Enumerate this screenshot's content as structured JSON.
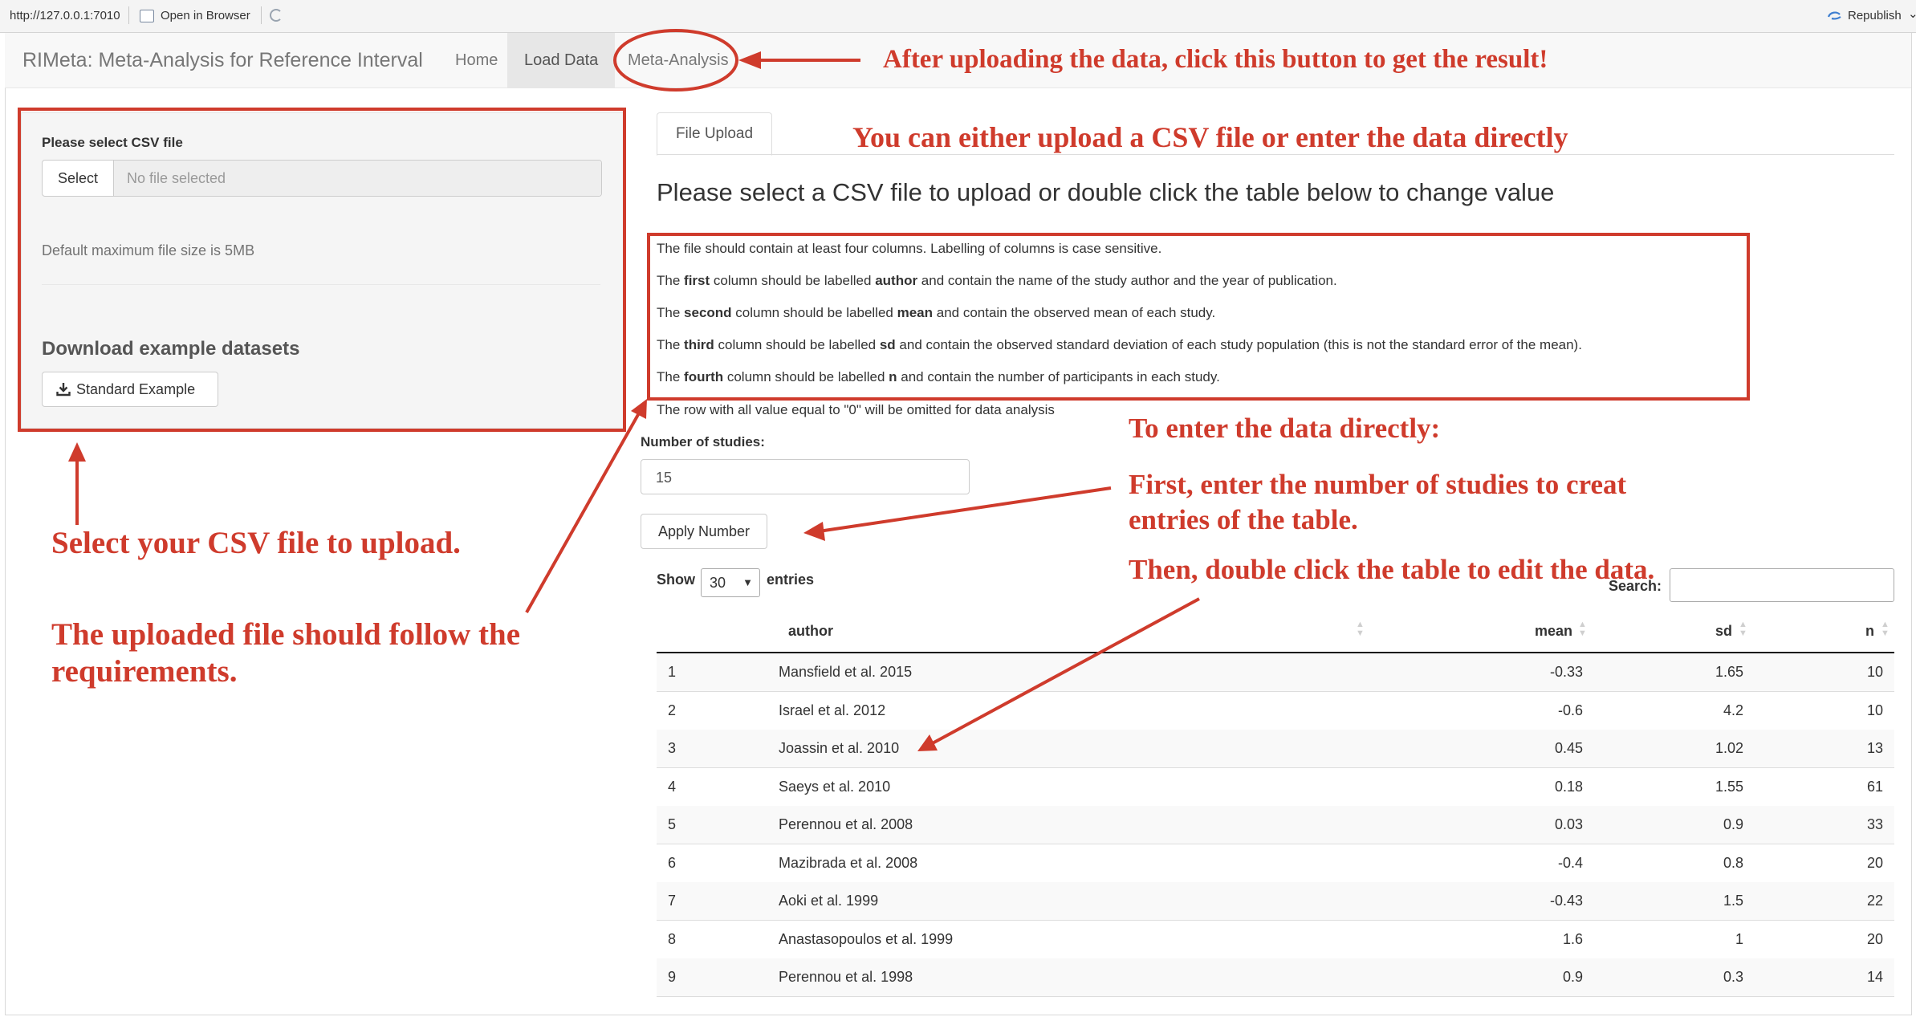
{
  "viewer": {
    "url": "http://127.0.0.1:7010",
    "open_in_browser": "Open in Browser",
    "republish": "Republish"
  },
  "navbar": {
    "brand": "RIMeta: Meta-Analysis for Reference Interval",
    "links": [
      "Home",
      "Load Data",
      "Meta-Analysis"
    ],
    "active": "Load Data"
  },
  "sidebar": {
    "file_label": "Please select CSV file",
    "select_button": "Select",
    "no_file": "No file selected",
    "help": "Default maximum file size is 5MB",
    "download_heading": "Download example datasets",
    "example_button": "Standard Example"
  },
  "main": {
    "tab": "File Upload",
    "heading": "Please select a CSV file to upload or double click the table below to change value",
    "requirements": [
      {
        "pre": "The file should contain at least four columns. Labelling of columns is case sensitive.",
        "b1": "",
        "mid": "",
        "b2": "",
        "post": ""
      },
      {
        "pre": "The ",
        "b1": "first",
        "mid": " column should be labelled ",
        "b2": "author",
        "post": " and contain the name of the study author and the year of publication."
      },
      {
        "pre": "The ",
        "b1": "second",
        "mid": " column should be labelled ",
        "b2": "mean",
        "post": " and contain the observed mean of each study."
      },
      {
        "pre": "The ",
        "b1": "third",
        "mid": " column should be labelled ",
        "b2": "sd",
        "post": " and contain the observed standard deviation of each study population (this is not the standard error of the mean)."
      },
      {
        "pre": "The ",
        "b1": "fourth",
        "mid": " column should be labelled ",
        "b2": "n",
        "post": " and contain the number of participants in each study."
      }
    ],
    "zero_note": "The row with all value equal to \"0\" will be omitted for data analysis",
    "num_studies_label": "Number of studies:",
    "num_studies_value": "15",
    "apply_button": "Apply Number"
  },
  "table": {
    "show": "Show",
    "entries": "entries",
    "page_length": "30",
    "search_label": "Search:",
    "columns": [
      "author",
      "mean",
      "sd",
      "n"
    ],
    "rows": [
      [
        "1",
        "Mansfield et al. 2015",
        "-0.33",
        "1.65",
        "10"
      ],
      [
        "2",
        "Israel et al. 2012",
        "-0.6",
        "4.2",
        "10"
      ],
      [
        "3",
        "Joassin et al. 2010",
        "0.45",
        "1.02",
        "13"
      ],
      [
        "4",
        "Saeys et al. 2010",
        "0.18",
        "1.55",
        "61"
      ],
      [
        "5",
        "Perennou et al. 2008",
        "0.03",
        "0.9",
        "33"
      ],
      [
        "6",
        "Mazibrada et al. 2008",
        "-0.4",
        "0.8",
        "20"
      ],
      [
        "7",
        "Aoki et al. 1999",
        "-0.43",
        "1.5",
        "22"
      ],
      [
        "8",
        "Anastasopoulos et al. 1999",
        "1.6",
        "1",
        "20"
      ],
      [
        "9",
        "Perennou et al. 1998",
        "0.9",
        "0.3",
        "14"
      ]
    ]
  },
  "annotations": {
    "nav_hint": "After uploading the data, click this button to get the result!",
    "tab_hint": "You can either upload a CSV file or enter the data directly",
    "select_hint": "Select your CSV file to upload.",
    "follow_hint_1": "The uploaded file should follow the",
    "follow_hint_2": "requirements.",
    "direct_title": "To enter the data directly:",
    "direct_step1_a": "First, enter the number of studies to creat",
    "direct_step1_b": "entries of the table.",
    "direct_step2": "Then, double click the table to edit the data."
  },
  "colors": {
    "annotation": "#cf3b2c",
    "navbar_bg": "#f8f8f8",
    "well_bg": "#f5f5f5"
  }
}
